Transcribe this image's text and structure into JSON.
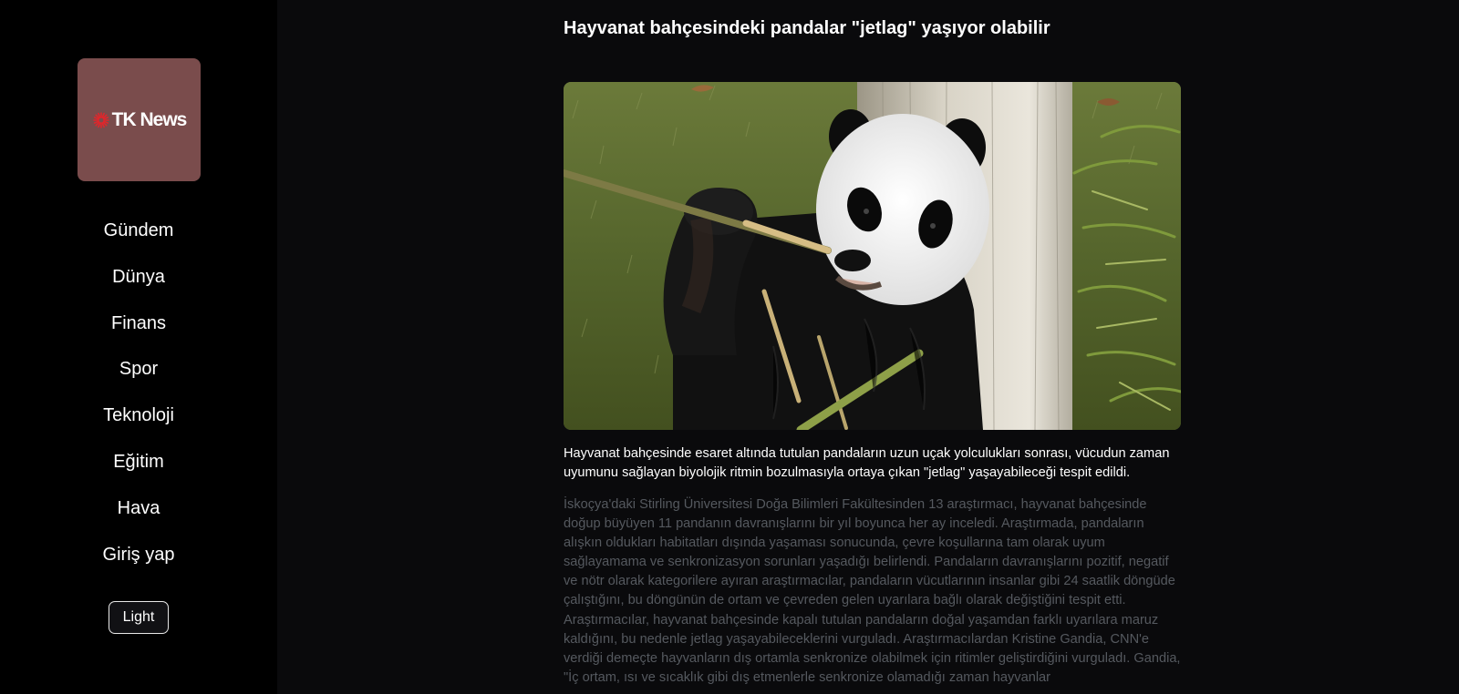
{
  "brand": {
    "logo_text": "TK News",
    "logo_color": "#7a4c4c",
    "accent": "#e0262b"
  },
  "nav": {
    "items": [
      {
        "label": "Gündem"
      },
      {
        "label": "Dünya"
      },
      {
        "label": "Finans"
      },
      {
        "label": "Spor"
      },
      {
        "label": "Teknoloji"
      },
      {
        "label": "Eğitim"
      },
      {
        "label": "Hava"
      },
      {
        "label": "Giriş yap"
      }
    ],
    "theme_toggle": "Light"
  },
  "article": {
    "title": "Hayvanat bahçesindeki pandalar \"jetlag\" yaşıyor olabilir",
    "image_icon": "panda-eating-bamboo-photo",
    "summary": "Hayvanat bahçesinde esaret altında tutulan pandaların uzun uçak yolculukları sonrası, vücudun zaman uyumunu sağlayan biyolojik ritmin bozulmasıyla ortaya çıkan \"jetlag\" yaşayabileceği tespit edildi.",
    "body": "İskoçya'daki Stirling Üniversitesi Doğa Bilimleri Fakültesinden 13 araştırmacı, hayvanat bahçesinde doğup büyüyen 11 pandanın davranışlarını bir yıl boyunca her ay inceledi. Araştırmada, pandaların alışkın oldukları habitatları dışında yaşaması sonucunda, çevre koşullarına tam olarak uyum sağlayamama ve senkronizasyon sorunları yaşadığı belirlendi. Pandaların davranışlarını pozitif, negatif ve nötr olarak kategorilere ayıran araştırmacılar, pandaların vücutlarının insanlar gibi 24 saatlik döngüde çalıştığını, bu döngünün de ortam ve çevreden gelen uyarılara bağlı olarak değiştiğini tespit etti. Araştırmacılar, hayvanat bahçesinde kapalı tutulan pandaların doğal yaşamdan farklı uyarılara maruz kaldığını, bu nedenle jetlag yaşayabileceklerini vurguladı. Araştırmacılardan Kristine Gandia, CNN'e verdiği demeçte hayvanların dış ortamla senkronize olabilmek için ritimler geliştirdiğini vurguladı. Gandia, \"İç ortam, ısı ve sıcaklık gibi dış etmenlerle senkronize olamadığı zaman hayvanlar"
  }
}
